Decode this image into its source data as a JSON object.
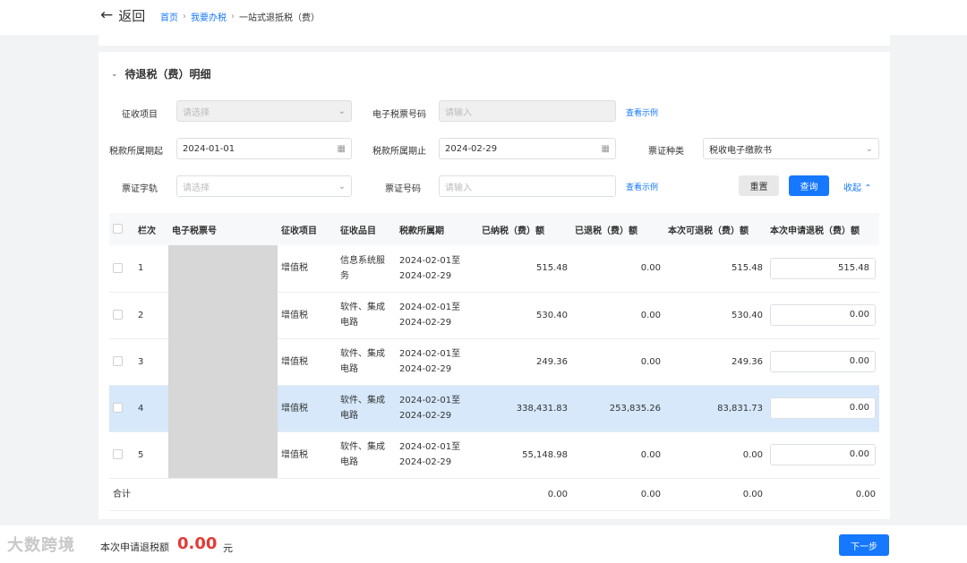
{
  "header": {
    "back_label": "返回",
    "breadcrumb": [
      "首页",
      "我要办税",
      "一站式退抵税（费）"
    ]
  },
  "section": {
    "title": "待退税（费）明细"
  },
  "filters": {
    "levy_item": {
      "label": "征收项目",
      "placeholder": "请选择"
    },
    "e_ticket_no": {
      "label": "电子税票号码",
      "placeholder": "请输入"
    },
    "view_example_1": "查看示例",
    "period_start": {
      "label": "税款所属期起",
      "value": "2024-01-01"
    },
    "period_end": {
      "label": "税款所属期止",
      "value": "2024-02-29"
    },
    "ticket_type": {
      "label": "票证种类",
      "value": "税收电子缴款书"
    },
    "ticket_word": {
      "label": "票证字轨",
      "placeholder": "请选择"
    },
    "ticket_no": {
      "label": "票证号码",
      "placeholder": "请输入"
    },
    "view_example_2": "查看示例",
    "reset_label": "重置",
    "query_label": "查询",
    "collapse_label": "收起"
  },
  "table": {
    "columns": [
      "栏次",
      "电子税票号",
      "征收项目",
      "征收品目",
      "税款所属期",
      "已纳税（费）额",
      "已退税（费）额",
      "本次可退税（费）额",
      "本次申请退税（费）额"
    ],
    "rows": [
      {
        "no": "1",
        "item": "增值税",
        "subitem": "信息系统服务",
        "period": "2024-02-01至2024-02-29",
        "paid": "515.48",
        "refunded": "0.00",
        "refundable": "515.48",
        "apply": "515.48"
      },
      {
        "no": "2",
        "item": "增值税",
        "subitem": "软件、集成电路",
        "period": "2024-02-01至2024-02-29",
        "paid": "530.40",
        "refunded": "0.00",
        "refundable": "530.40",
        "apply": "0.00"
      },
      {
        "no": "3",
        "item": "增值税",
        "subitem": "软件、集成电路",
        "period": "2024-02-01至2024-02-29",
        "paid": "249.36",
        "refunded": "0.00",
        "refundable": "249.36",
        "apply": "0.00"
      },
      {
        "no": "4",
        "item": "增值税",
        "subitem": "软件、集成电路",
        "period": "2024-02-01至2024-02-29",
        "paid": "338,431.83",
        "refunded": "253,835.26",
        "refundable": "83,831.73",
        "apply": "0.00"
      },
      {
        "no": "5",
        "item": "增值税",
        "subitem": "软件、集成电路",
        "period": "2024-02-01至2024-02-29",
        "paid": "55,148.98",
        "refunded": "0.00",
        "refundable": "0.00",
        "apply": "0.00"
      }
    ],
    "summary": {
      "label": "合计",
      "paid": "0.00",
      "refunded": "0.00",
      "refundable": "0.00",
      "apply": "0.00"
    }
  },
  "footer": {
    "watermark": "大数跨境",
    "total_label": "本次申请退税额",
    "total_value": "0.00",
    "total_unit": "元",
    "next_label": "下一步"
  },
  "colors": {
    "accent": "#1677ff",
    "selected_row": "#d6e8fa",
    "total": "#e53935",
    "summary": "#f5a623"
  }
}
